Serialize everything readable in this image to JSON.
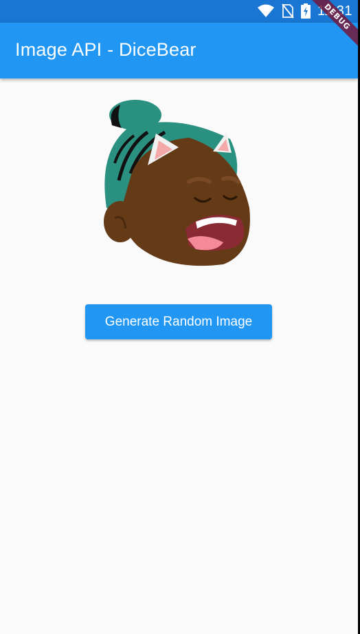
{
  "status_bar": {
    "time": "11:31",
    "icons": [
      "wifi-icon",
      "no-sim-icon",
      "battery-charging-icon"
    ]
  },
  "app_bar": {
    "title": "Image API - DiceBear"
  },
  "debug_banner": {
    "label": "DEBUG"
  },
  "main": {
    "generate_button_label": "Generate Random Image"
  },
  "colors": {
    "status_bar": "#1976d2",
    "app_bar": "#2196f3",
    "button": "#2196f3",
    "background": "#fafafa",
    "hair": "#2a9080",
    "skin": "#643a17"
  }
}
